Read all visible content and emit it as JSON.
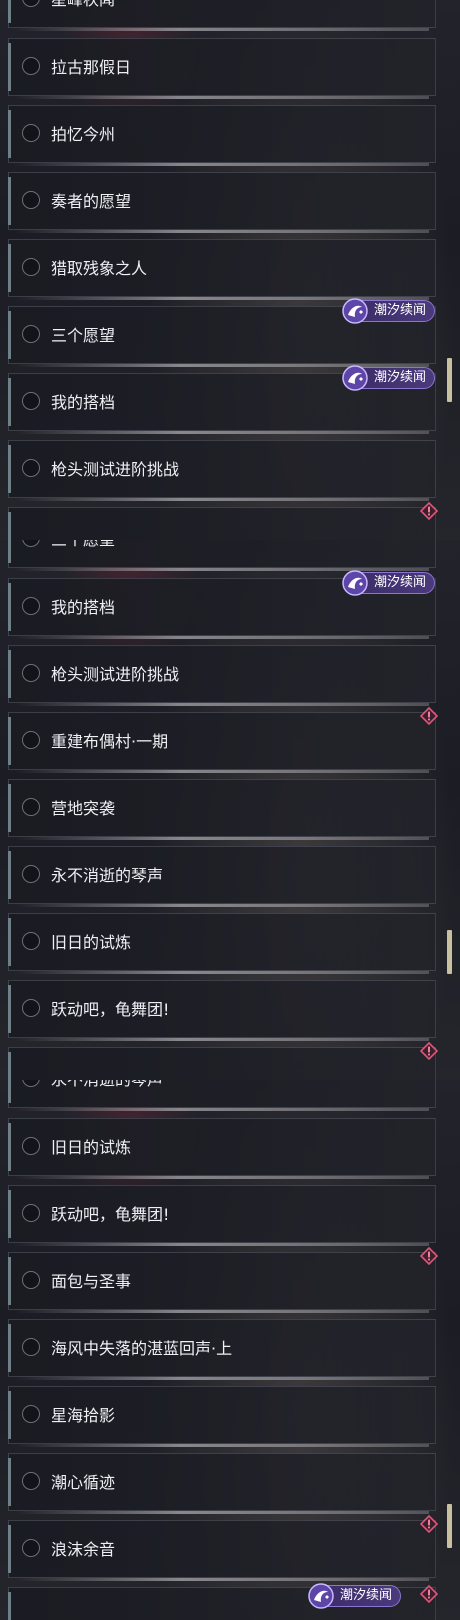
{
  "badge_text": "潮汐续闻",
  "colors": {
    "badge_bg": "#3b2a66",
    "badge_border": "#8b75d0",
    "warning": "#e0557a",
    "scroll_thumb": "#c9c0a0"
  },
  "panels": [
    {
      "items": [
        "星峰秩闻",
        "拉古那假日",
        "拍忆今州",
        "奏者的愿望",
        "猎取残象之人",
        "三个愿望",
        "我的搭档",
        "枪头测试进阶挑战"
      ],
      "flags": [
        "none",
        "none",
        "none",
        "none",
        "none",
        "tide",
        "tide",
        "none",
        "warning"
      ]
    },
    {
      "items": [
        "三个愿望",
        "我的搭档",
        "枪头测试进阶挑战",
        "重建布偶村·一期",
        "营地突袭",
        "永不消逝的琴声",
        "旧日的试炼",
        "跃动吧，龟舞团!"
      ],
      "flags": [
        "tide",
        "none",
        "warning",
        "none",
        "none",
        "none",
        "none",
        "warning"
      ]
    },
    {
      "items": [
        "永不消逝的琴声",
        "旧日的试炼",
        "跃动吧，龟舞团!",
        "面包与圣事",
        "海风中失落的湛蓝回声·上",
        "星海拾影",
        "潮心循迹",
        "浪沫余音"
      ],
      "flags": [
        "none",
        "none",
        "warning",
        "none",
        "none",
        "none",
        "warning",
        "tide"
      ]
    }
  ]
}
